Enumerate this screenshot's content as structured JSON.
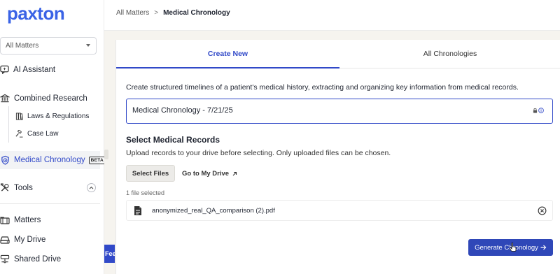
{
  "app": {
    "logo": "paxton"
  },
  "sidebar": {
    "matter_select": "All Matters",
    "items": [
      {
        "label": "AI Assistant",
        "icon": "chat-icon"
      },
      {
        "label": "Combined Research",
        "icon": "bank-icon"
      },
      {
        "label": "Laws & Regulations",
        "icon": "book-icon"
      },
      {
        "label": "Case Law",
        "icon": "gavel-icon"
      },
      {
        "label": "Medical Chronology",
        "icon": "medical-icon",
        "badge": "BETA"
      },
      {
        "label": "Tools",
        "icon": "tools-icon"
      },
      {
        "label": "Matters",
        "icon": "folder-icon"
      },
      {
        "label": "My Drive",
        "icon": "drive-icon"
      },
      {
        "label": "Shared Drive",
        "icon": "shared-drive-icon"
      }
    ],
    "feedback_tab": "Feedback"
  },
  "breadcrumb": {
    "root": "All Matters",
    "separator": ">",
    "current": "Medical Chronology"
  },
  "tabs": [
    {
      "label": "Create New",
      "active": true
    },
    {
      "label": "All Chronologies",
      "active": false
    }
  ],
  "main": {
    "intro": "Create structured timelines of a patient's medical history, extracting and organizing key information from medical records.",
    "title_value": "Medical Chronology - 7/21/25",
    "section_title": "Select Medical Records",
    "section_subtitle": "Upload records to your drive before selecting. Only uploaded files can be chosen.",
    "select_files_label": "Select Files",
    "drive_link_label": "Go to My Drive",
    "file_count": "1 file selected",
    "files": [
      {
        "name": "anonymized_real_QA_comparison (2).pdf"
      }
    ],
    "generate_label": "Generate Chronology"
  },
  "colors": {
    "accent": "#3149c8",
    "button_primary": "#2f47b8",
    "background": "#f6f4ef"
  }
}
